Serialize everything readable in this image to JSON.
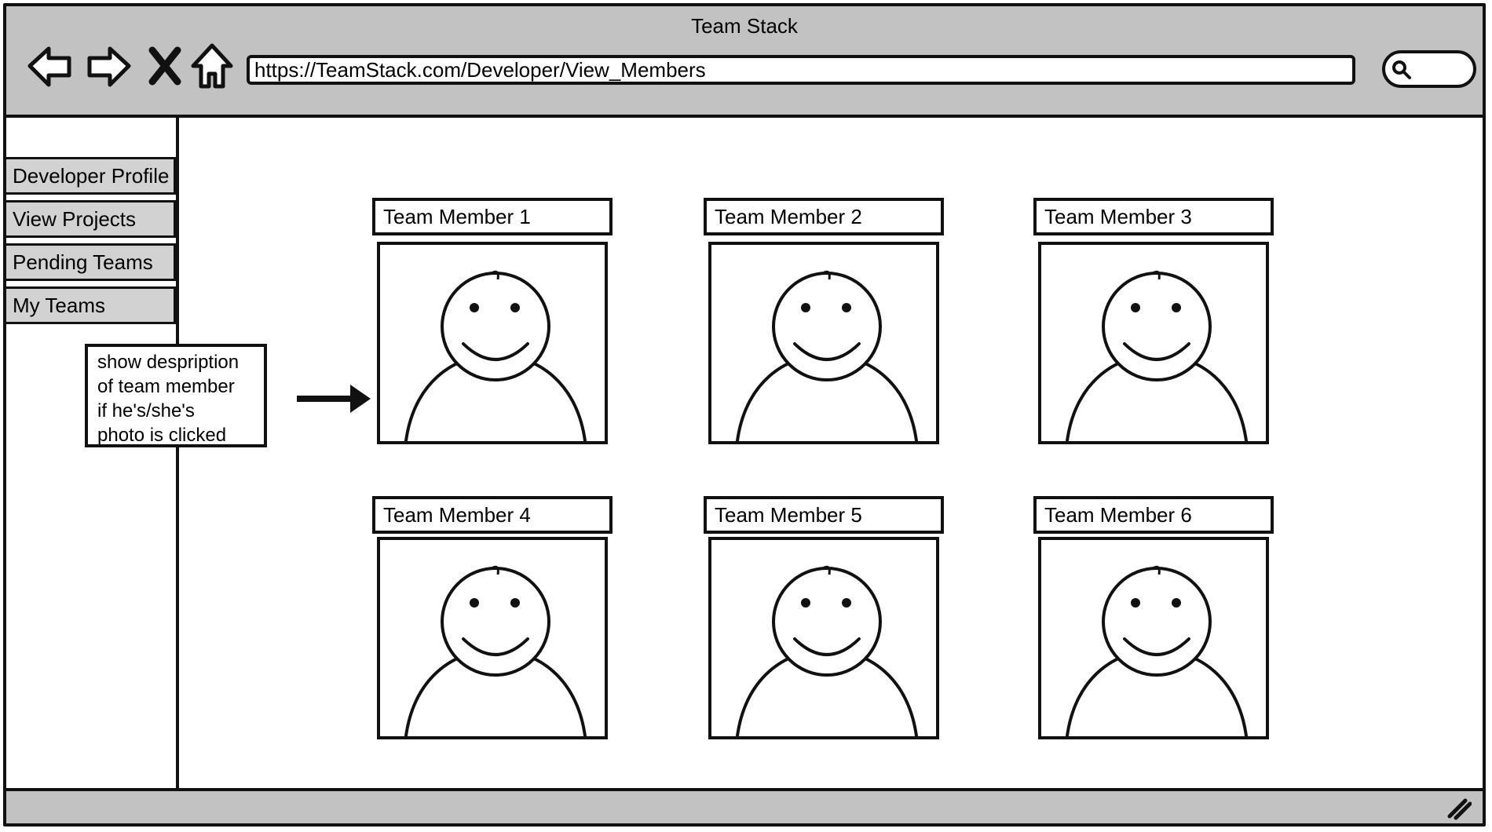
{
  "window": {
    "title": "Team Stack"
  },
  "toolbar": {
    "back_icon": "back-arrow-icon",
    "forward_icon": "forward-arrow-icon",
    "stop_icon": "close-icon",
    "home_icon": "home-icon",
    "url": "https://TeamStack.com/Developer/View_Members",
    "search_icon": "search-icon"
  },
  "sidebar": {
    "items": [
      {
        "label": "Developer Profile"
      },
      {
        "label": "View Projects"
      },
      {
        "label": "Pending Teams"
      },
      {
        "label": "My Teams"
      }
    ]
  },
  "note": {
    "lines": [
      "show despription",
      "of team member",
      "if he's/she's",
      "photo is clicked"
    ]
  },
  "members": [
    {
      "name": "Team Member 1",
      "photo_icon": "person-avatar-icon"
    },
    {
      "name": "Team Member 2",
      "photo_icon": "person-avatar-icon"
    },
    {
      "name": "Team Member 3",
      "photo_icon": "person-avatar-icon"
    },
    {
      "name": "Team Member 4",
      "photo_icon": "person-avatar-icon"
    },
    {
      "name": "Team Member 5",
      "photo_icon": "person-avatar-icon"
    },
    {
      "name": "Team Member 6",
      "photo_icon": "person-avatar-icon"
    }
  ],
  "statusbar": {
    "resize_icon": "resize-grip-icon"
  },
  "colors": {
    "chrome": "#c2c2c2",
    "sidebar_item": "#d2d2d2",
    "stroke": "#111111",
    "canvas": "#ffffff"
  }
}
